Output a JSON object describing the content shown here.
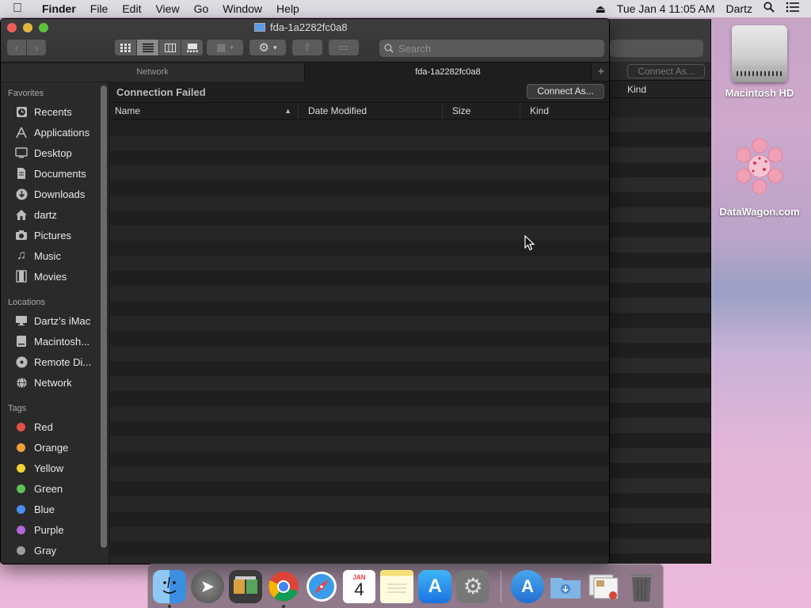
{
  "menubar": {
    "app_name": "Finder",
    "items": [
      "File",
      "Edit",
      "View",
      "Go",
      "Window",
      "Help"
    ],
    "clock": "Tue Jan 4  11:05 AM",
    "user": "Dartz"
  },
  "desktop": {
    "icons": [
      {
        "label": "Macintosh HD"
      },
      {
        "label": "DataWagon.com"
      }
    ]
  },
  "window": {
    "title": "fda-1a2282fc0a8",
    "search_placeholder": "Search",
    "tabs": [
      {
        "label": "Network"
      },
      {
        "label": "fda-1a2282fc0a8"
      }
    ],
    "status_label": "Connection Failed",
    "connect_button": "Connect As...",
    "columns": [
      "Name",
      "Date Modified",
      "Size",
      "Kind"
    ]
  },
  "back_window": {
    "connect_button": "Connect As...",
    "kind_label": "Kind"
  },
  "sidebar": {
    "favorites_header": "Favorites",
    "favorites": [
      {
        "label": "Recents",
        "icon": "clock-icon"
      },
      {
        "label": "Applications",
        "icon": "applications-icon"
      },
      {
        "label": "Desktop",
        "icon": "desktop-icon"
      },
      {
        "label": "Documents",
        "icon": "documents-icon"
      },
      {
        "label": "Downloads",
        "icon": "downloads-icon"
      },
      {
        "label": "dartz",
        "icon": "home-icon"
      },
      {
        "label": "Pictures",
        "icon": "camera-icon"
      },
      {
        "label": "Music",
        "icon": "music-icon"
      },
      {
        "label": "Movies",
        "icon": "film-icon"
      }
    ],
    "locations_header": "Locations",
    "locations": [
      {
        "label": "Dartz’s iMac",
        "icon": "imac-icon"
      },
      {
        "label": "Macintosh...",
        "icon": "disk-icon"
      },
      {
        "label": "Remote Di...",
        "icon": "remote-disc-icon"
      },
      {
        "label": "Network",
        "icon": "network-icon"
      }
    ],
    "tags_header": "Tags",
    "tags": [
      {
        "label": "Red",
        "color": "#e2524a"
      },
      {
        "label": "Orange",
        "color": "#eda23a"
      },
      {
        "label": "Yellow",
        "color": "#f0d437"
      },
      {
        "label": "Green",
        "color": "#5ec155"
      },
      {
        "label": "Blue",
        "color": "#4d8ef0"
      },
      {
        "label": "Purple",
        "color": "#b566d8"
      },
      {
        "label": "Gray",
        "color": "#9c9c9c"
      }
    ]
  },
  "dock": {
    "calendar_month": "JAN",
    "calendar_day": "4"
  }
}
